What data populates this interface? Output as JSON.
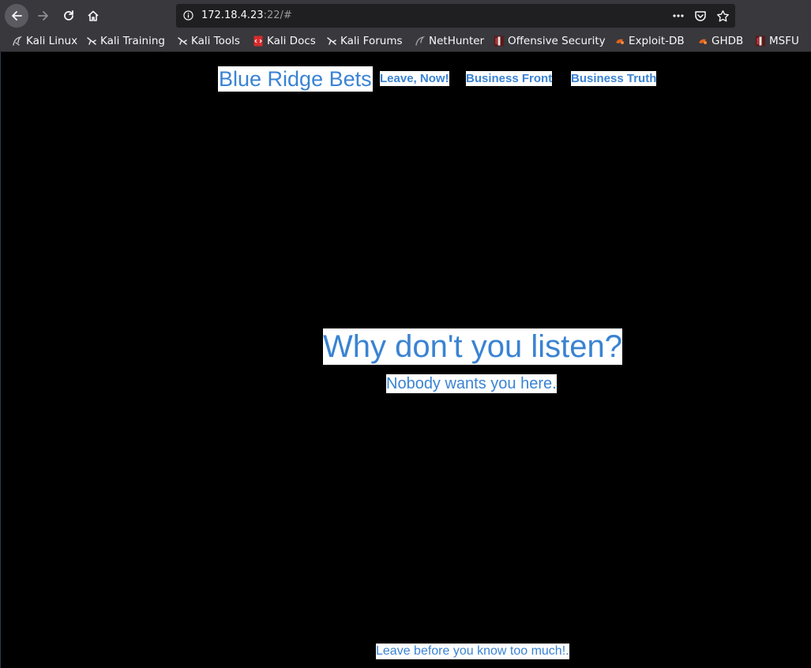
{
  "browser": {
    "url_host": "172.18.4.23",
    "url_rest": ":22/#",
    "bookmarks": [
      {
        "label": "Kali Linux",
        "icon": "kali-dragon-icon"
      },
      {
        "label": "Kali Training",
        "icon": "kali-dragon-icon"
      },
      {
        "label": "Kali Tools",
        "icon": "kali-dragon-icon"
      },
      {
        "label": "Kali Docs",
        "icon": "kali-docs-icon"
      },
      {
        "label": "Kali Forums",
        "icon": "kali-dragon-icon"
      },
      {
        "label": "NetHunter",
        "icon": "nethunter-icon"
      },
      {
        "label": "Offensive Security",
        "icon": "offensive-security-icon"
      },
      {
        "label": "Exploit-DB",
        "icon": "exploit-db-icon"
      },
      {
        "label": "GHDB",
        "icon": "ghdb-icon"
      },
      {
        "label": "MSFU",
        "icon": "msfu-icon"
      }
    ]
  },
  "page": {
    "site_title": "Blue Ridge Bets",
    "nav": [
      {
        "label": "Leave, Now!"
      },
      {
        "label": "Business Front"
      },
      {
        "label": "Business Truth"
      }
    ],
    "hero_heading": "Why don't you listen?",
    "hero_subtext": "Nobody wants you here.",
    "footer_link": "Leave before you know too much!."
  },
  "colors": {
    "page_background": "#000000",
    "text_accent": "#3a83d3",
    "highlight_background": "#ffffff",
    "toolbar_background": "#38383d"
  }
}
